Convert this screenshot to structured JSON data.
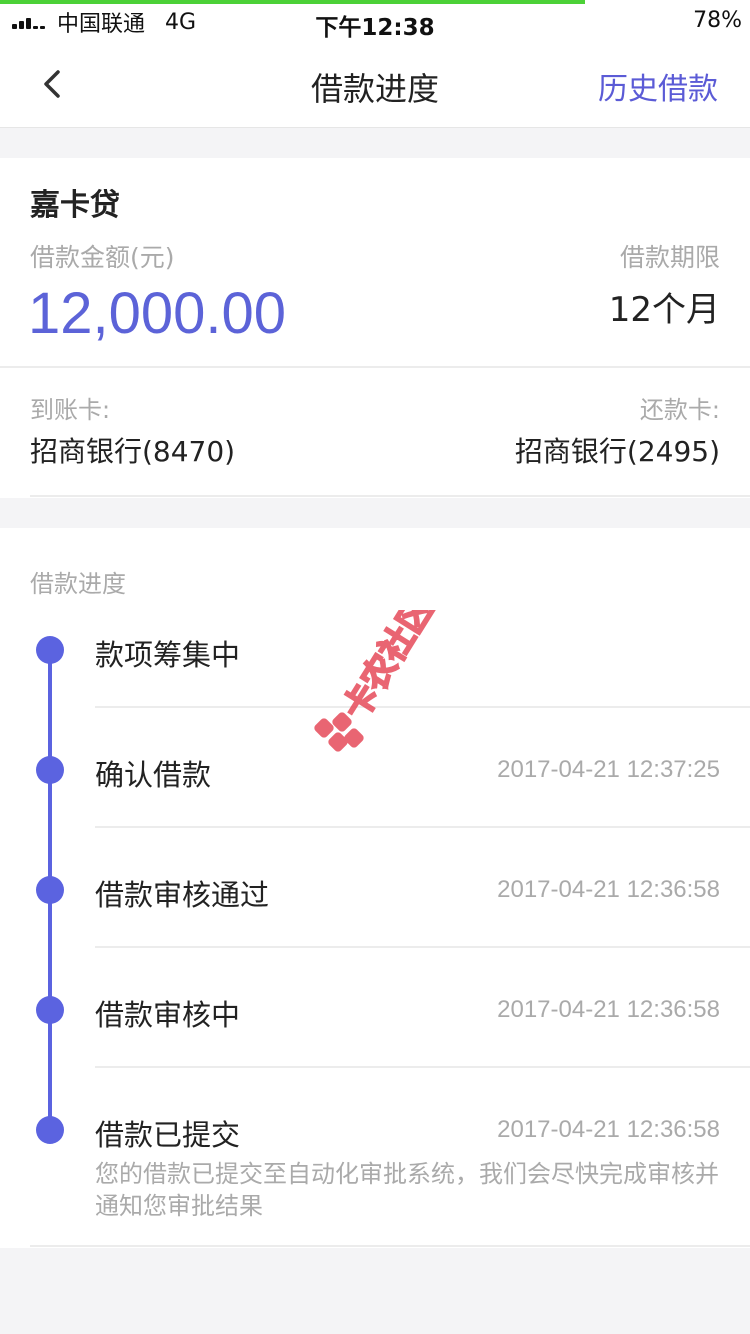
{
  "status_bar": {
    "carrier": "中国联通",
    "network": "4G",
    "time": "下午12:38",
    "battery": "78%"
  },
  "nav": {
    "title": "借款进度",
    "history_link": "历史借款",
    "back_icon": "chevron-left-icon"
  },
  "loan": {
    "product_name": "嘉卡贷",
    "amount_label": "借款金额(元)",
    "amount_value": "12,000.00",
    "term_label": "借款期限",
    "term_value": "12个月",
    "receive_card_label": "到账卡:",
    "receive_card_value": "招商银行(8470)",
    "repay_card_label": "还款卡:",
    "repay_card_value": "招商银行(2495)"
  },
  "progress": {
    "title": "借款进度",
    "steps": [
      {
        "label": "款项筹集中",
        "time": ""
      },
      {
        "label": "确认借款",
        "time": "2017-04-21 12:37:25"
      },
      {
        "label": "借款审核通过",
        "time": "2017-04-21 12:36:58"
      },
      {
        "label": "借款审核中",
        "time": "2017-04-21 12:36:58"
      },
      {
        "label": "借款已提交",
        "time": "2017-04-21 12:36:58",
        "description": "您的借款已提交至自动化审批系统，我们会尽快完成审核并通知您审批结果"
      }
    ]
  },
  "watermark": {
    "text": "卡农社区",
    "icon": "kanong-logo-icon"
  },
  "colors": {
    "accent": "#5b63e0",
    "amount": "#5c63d8",
    "link": "#5b5bd6",
    "muted": "#aaaaaa",
    "load_bar": "#4cd137"
  }
}
